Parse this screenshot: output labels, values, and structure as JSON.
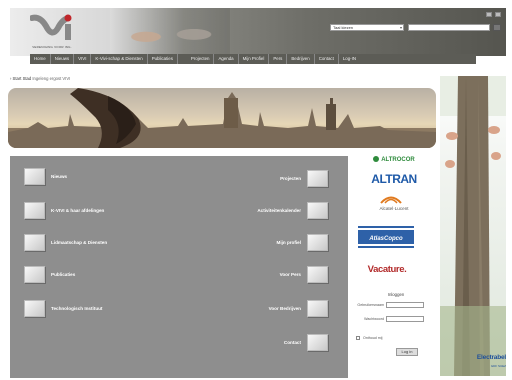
{
  "header": {
    "logo_caption": "VERENIGING VOOR ING.",
    "language_select": "Taal kiezen",
    "nav": [
      "Home",
      "Nieuws",
      "VIVI",
      "K-Vivi-schap & Diensten",
      "Publicaties",
      "",
      "Projecten",
      "Agenda",
      "Mijn Profiel",
      "Pers",
      "Bedrijven",
      "Contact",
      "Log-IN"
    ]
  },
  "breadcrumb": {
    "home": "› Start Stad",
    "current": "Ingeleng ergost VIVI"
  },
  "tiles_left": [
    "Nieuws",
    "K-VIVI & haar afdelingen",
    "Lidmaatschap & Diensten",
    "Publicaties",
    "Technologisch Instituut"
  ],
  "tiles_right": [
    "Projecten",
    "Activiteitenkalender",
    "Mijn profiel",
    "Voor Pers",
    "Voor Bedrijven",
    "Contact"
  ],
  "sponsors": {
    "altrocor": "ALTROCOR",
    "altran": "ALTRAN",
    "alcatel": "Alcatel·Lucent",
    "atlas": "AtlasCopco",
    "vacature": "Vacature."
  },
  "login": {
    "title": "Inloggen",
    "username_label": "Gebruikersnaam",
    "password_label": "Wachtwoord",
    "remember_label": "Onthoud mij",
    "button": "Log in"
  },
  "ad": {
    "brand": "Electrabel",
    "tagline": "GDF SUEZ"
  },
  "colors": {
    "panel": "#8e8e8e",
    "nav": "#5c5c56",
    "altran": "#1f5aa8",
    "vacature": "#b22a2a",
    "electrabel": "#1d4f9a"
  }
}
